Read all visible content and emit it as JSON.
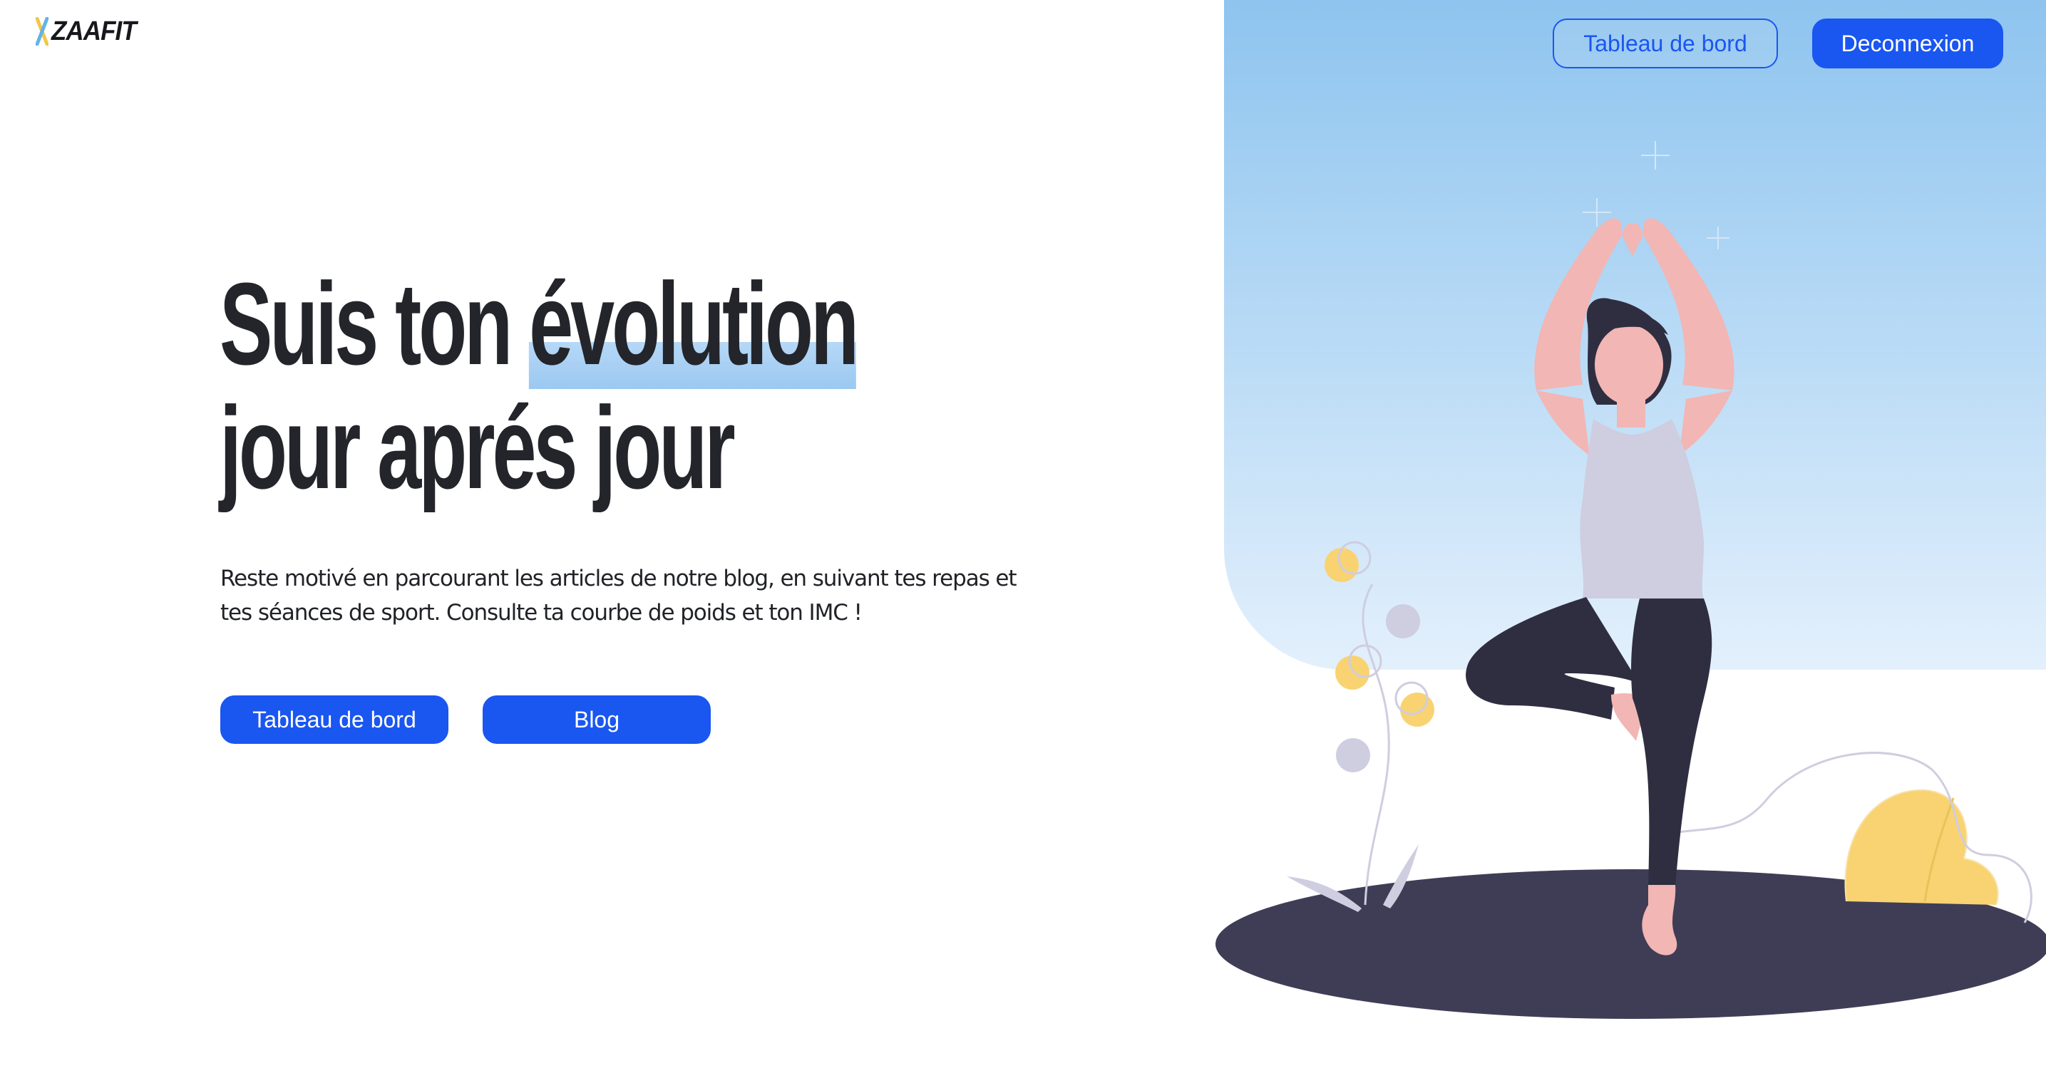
{
  "brand": {
    "logo_text": "ZAAFIT"
  },
  "nav": {
    "dashboard_label": "Tableau de bord",
    "logout_label": "Deconnexion"
  },
  "hero": {
    "title_line1_prefix": "Suis ton ",
    "title_line1_highlight": "évolution",
    "title_line2": "jour aprés jour",
    "lead": "Reste motivé en parcourant les articles de notre blog, en suivant tes repas et tes séances de sport. Consulte ta courbe de poids et ton IMC !",
    "cta_dashboard_label": "Tableau de bord",
    "cta_blog_label": "Blog"
  },
  "colors": {
    "primary": "#1a56f0",
    "text_dark": "#23252b",
    "sky_top": "#8ec4ef",
    "sky_bottom": "#e3f0fc",
    "highlight": "#b6d8f7",
    "skin": "#f2b6b4",
    "hair": "#2f2e41",
    "top": "#cfcde0",
    "pants": "#2f2e41",
    "mat": "#3f3d56",
    "accent_yellow": "#f9d371"
  },
  "icons": {
    "logo_mark": "dumbbell-icon",
    "sparkles": "sparkle-icon"
  }
}
